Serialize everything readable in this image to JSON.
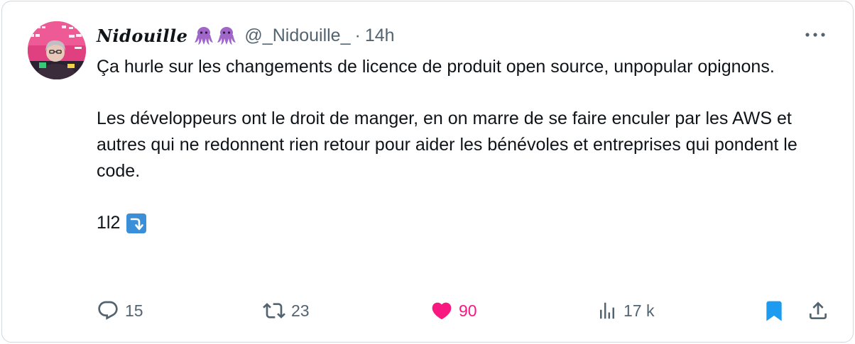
{
  "tweet": {
    "display_name": "Nidouille",
    "name_emojis": [
      "octopus-icon",
      "octopus-icon"
    ],
    "handle": "@_Nidouille_",
    "separator": "·",
    "time": "14h",
    "paragraphs": [
      "Ça hurle sur les changements de licence de produit open source, unpopular opignons.",
      "Les développeurs ont le droit de manger, en on marre de se faire enculer par les AWS et autres qui ne redonnent rien retour pour aider les bénévoles et entreprises qui pondent le code."
    ],
    "thread_counter": "1l2",
    "thread_emoji": "right-arrow-curving-down-icon"
  },
  "actions": {
    "replies": "15",
    "retweets": "23",
    "likes": "90",
    "views": "17 k"
  },
  "colors": {
    "text_primary": "#0f1419",
    "text_secondary": "#536471",
    "like": "#f91880",
    "bookmark": "#1d9bf0",
    "border": "#cfd9de",
    "octopus": "#a066c8"
  }
}
